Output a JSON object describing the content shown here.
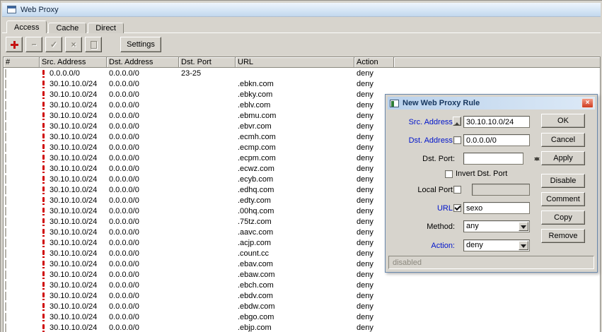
{
  "window": {
    "title": "Web Proxy",
    "tabs": [
      "Access",
      "Cache",
      "Direct"
    ],
    "toolbar": {
      "remove_glyph": "−",
      "enable_glyph": "✓",
      "disable_glyph": "×",
      "settings": "Settings"
    }
  },
  "table": {
    "columns": [
      "#",
      "Src. Address",
      "Dst. Address",
      "Dst. Port",
      "URL",
      "Action"
    ],
    "rows": [
      {
        "src": "0.0.0.0/0",
        "dst": "0.0.0.0/0",
        "dst_port": "23-25",
        "url": "",
        "action": "deny"
      },
      {
        "src": "30.10.10.0/24",
        "dst": "0.0.0.0/0",
        "dst_port": "",
        "url": ".ebkn.com",
        "action": "deny"
      },
      {
        "src": "30.10.10.0/24",
        "dst": "0.0.0.0/0",
        "dst_port": "",
        "url": ".ebky.com",
        "action": "deny"
      },
      {
        "src": "30.10.10.0/24",
        "dst": "0.0.0.0/0",
        "dst_port": "",
        "url": ".eblv.com",
        "action": "deny"
      },
      {
        "src": "30.10.10.0/24",
        "dst": "0.0.0.0/0",
        "dst_port": "",
        "url": ".ebmu.com",
        "action": "deny"
      },
      {
        "src": "30.10.10.0/24",
        "dst": "0.0.0.0/0",
        "dst_port": "",
        "url": ".ebvr.com",
        "action": "deny"
      },
      {
        "src": "30.10.10.0/24",
        "dst": "0.0.0.0/0",
        "dst_port": "",
        "url": ".ecmh.com",
        "action": "deny"
      },
      {
        "src": "30.10.10.0/24",
        "dst": "0.0.0.0/0",
        "dst_port": "",
        "url": ".ecmp.com",
        "action": "deny"
      },
      {
        "src": "30.10.10.0/24",
        "dst": "0.0.0.0/0",
        "dst_port": "",
        "url": ".ecpm.com",
        "action": "deny"
      },
      {
        "src": "30.10.10.0/24",
        "dst": "0.0.0.0/0",
        "dst_port": "",
        "url": ".ecwz.com",
        "action": "deny"
      },
      {
        "src": "30.10.10.0/24",
        "dst": "0.0.0.0/0",
        "dst_port": "",
        "url": ".ecyb.com",
        "action": "deny"
      },
      {
        "src": "30.10.10.0/24",
        "dst": "0.0.0.0/0",
        "dst_port": "",
        "url": ".edhq.com",
        "action": "deny"
      },
      {
        "src": "30.10.10.0/24",
        "dst": "0.0.0.0/0",
        "dst_port": "",
        "url": ".edty.com",
        "action": "deny"
      },
      {
        "src": "30.10.10.0/24",
        "dst": "0.0.0.0/0",
        "dst_port": "",
        "url": ".00hq.com",
        "action": "deny"
      },
      {
        "src": "30.10.10.0/24",
        "dst": "0.0.0.0/0",
        "dst_port": "",
        "url": ".75tz.com",
        "action": "deny"
      },
      {
        "src": "30.10.10.0/24",
        "dst": "0.0.0.0/0",
        "dst_port": "",
        "url": ".aavc.com",
        "action": "deny"
      },
      {
        "src": "30.10.10.0/24",
        "dst": "0.0.0.0/0",
        "dst_port": "",
        "url": ".acjp.com",
        "action": "deny"
      },
      {
        "src": "30.10.10.0/24",
        "dst": "0.0.0.0/0",
        "dst_port": "",
        "url": ".count.cc",
        "action": "deny"
      },
      {
        "src": "30.10.10.0/24",
        "dst": "0.0.0.0/0",
        "dst_port": "",
        "url": ".ebav.com",
        "action": "deny"
      },
      {
        "src": "30.10.10.0/24",
        "dst": "0.0.0.0/0",
        "dst_port": "",
        "url": ".ebaw.com",
        "action": "deny"
      },
      {
        "src": "30.10.10.0/24",
        "dst": "0.0.0.0/0",
        "dst_port": "",
        "url": ".ebch.com",
        "action": "deny"
      },
      {
        "src": "30.10.10.0/24",
        "dst": "0.0.0.0/0",
        "dst_port": "",
        "url": ".ebdv.com",
        "action": "deny"
      },
      {
        "src": "30.10.10.0/24",
        "dst": "0.0.0.0/0",
        "dst_port": "",
        "url": ".ebdw.com",
        "action": "deny"
      },
      {
        "src": "30.10.10.0/24",
        "dst": "0.0.0.0/0",
        "dst_port": "",
        "url": ".ebgo.com",
        "action": "deny"
      },
      {
        "src": "30.10.10.0/24",
        "dst": "0.0.0.0/0",
        "dst_port": "",
        "url": ".ebjp.com",
        "action": "deny"
      }
    ]
  },
  "dialog": {
    "title": "New Web Proxy Rule",
    "close_glyph": "×",
    "src_address": {
      "label": "Src. Address:",
      "value": "30.10.10.0/24"
    },
    "dst_address": {
      "label": "Dst. Address:",
      "value": "0.0.0.0/0"
    },
    "dst_port": {
      "label": "Dst. Port:",
      "value": ""
    },
    "invert_dst_port": {
      "label": "Invert Dst. Port"
    },
    "local_port": {
      "label": "Local Port:",
      "value": ""
    },
    "url": {
      "label": "URL:",
      "value": "sexo"
    },
    "method": {
      "label": "Method:",
      "value": "any"
    },
    "action": {
      "label": "Action:",
      "value": "deny"
    },
    "buttons": [
      "OK",
      "Cancel",
      "Apply",
      "Disable",
      "Comment",
      "Copy",
      "Remove"
    ],
    "status": "disabled"
  },
  "colors": {
    "blue_label": "#0014cc",
    "deny_icon_red": "#cf0000",
    "window_bg": "#d7d4cd",
    "titlebar_blue": "#cfe1f3"
  }
}
